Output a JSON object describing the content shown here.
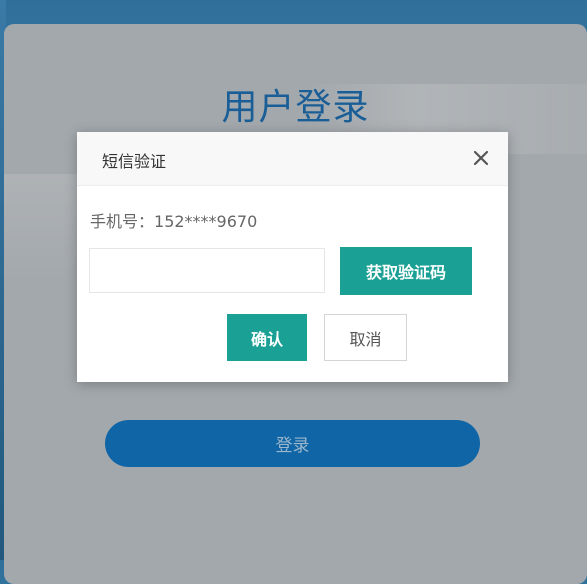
{
  "login": {
    "title": "用户登录",
    "login_button": "登录"
  },
  "modal": {
    "title": "短信验证",
    "phone_label": "手机号：",
    "phone_value": "152****9670",
    "code_input_value": "",
    "get_code_button": "获取验证码",
    "confirm_button": "确认",
    "cancel_button": "取消"
  },
  "colors": {
    "accent": "#1aa094",
    "brand_blue": "#0f65a5",
    "title_blue": "#1a5e97"
  }
}
